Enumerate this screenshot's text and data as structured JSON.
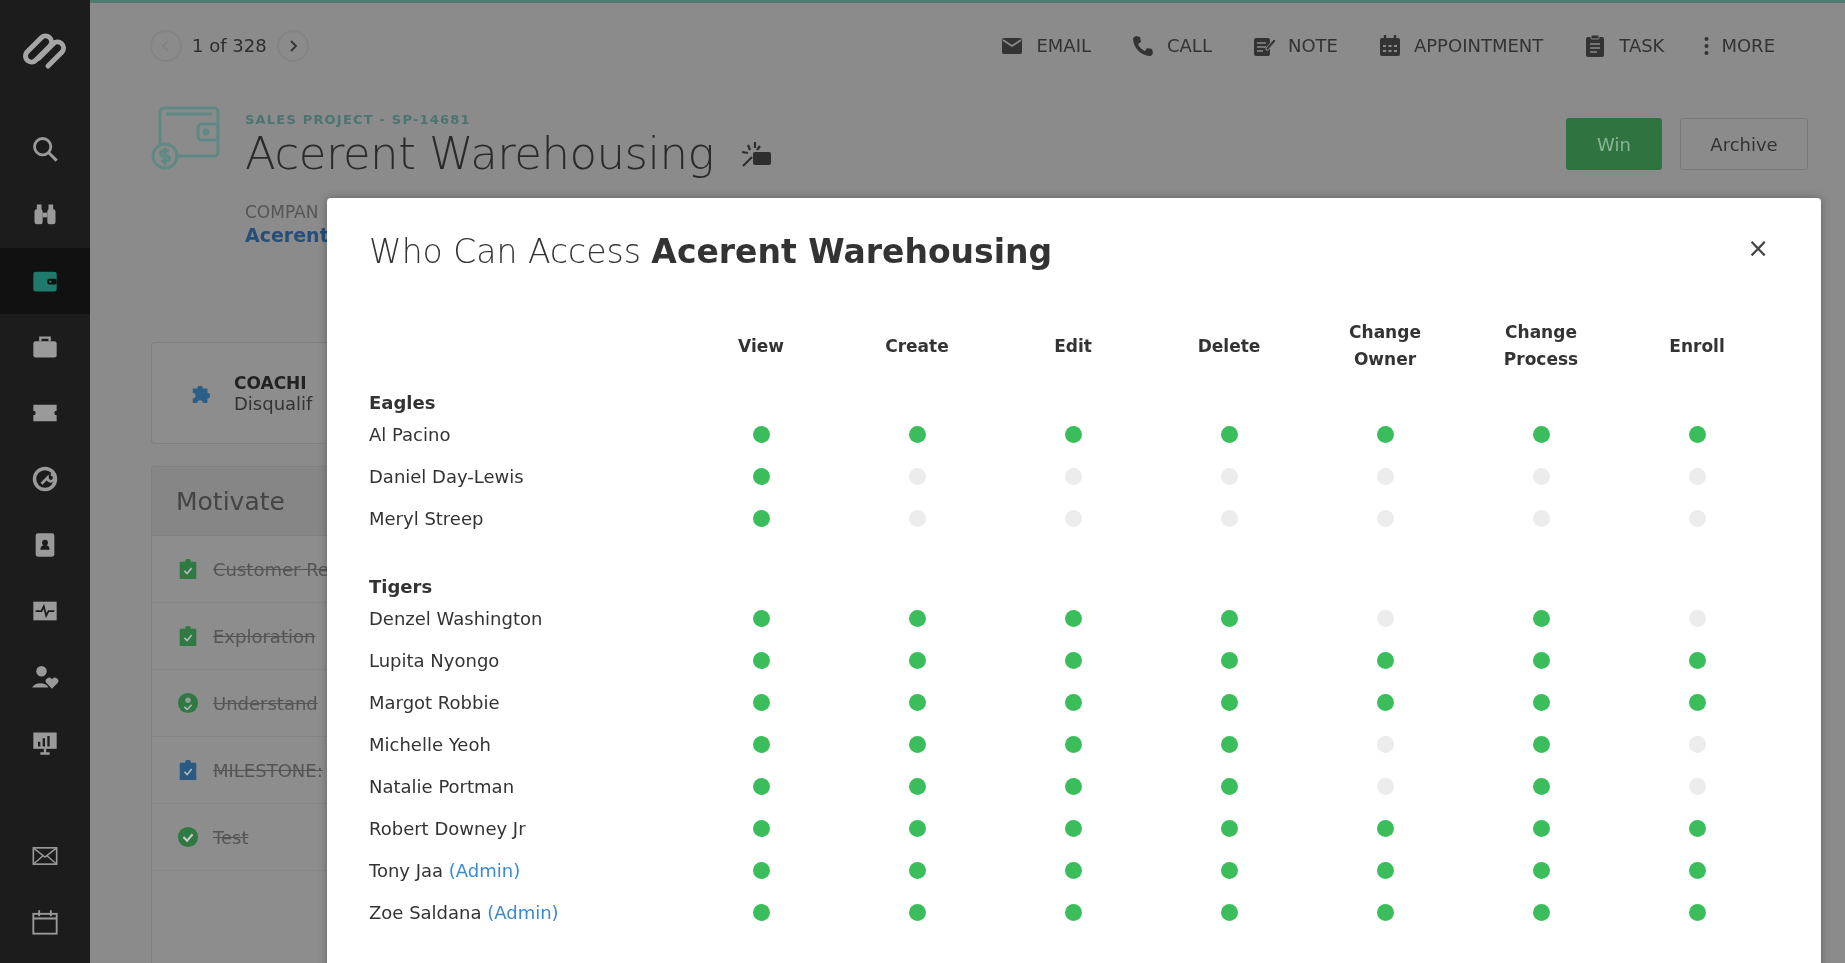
{
  "sidebar": {
    "items": [
      {
        "kind": "search",
        "selected": false
      },
      {
        "kind": "binoculars",
        "selected": false
      },
      {
        "kind": "wallet",
        "selected": true
      },
      {
        "kind": "briefcase",
        "selected": false
      },
      {
        "kind": "ticket",
        "selected": false
      },
      {
        "kind": "wrench",
        "selected": false
      },
      {
        "kind": "contacts",
        "selected": false
      },
      {
        "kind": "pulse",
        "selected": false
      },
      {
        "kind": "person-heart",
        "selected": false
      },
      {
        "kind": "chart",
        "selected": false
      }
    ],
    "bottom_items": [
      {
        "kind": "envelope",
        "selected": false
      },
      {
        "kind": "calendar",
        "selected": false
      }
    ]
  },
  "pager": {
    "position": "1 of 328"
  },
  "actions": [
    {
      "kind": "email",
      "label": "EMAIL"
    },
    {
      "kind": "call",
      "label": "CALL"
    },
    {
      "kind": "note",
      "label": "NOTE"
    },
    {
      "kind": "appointment",
      "label": "APPOINTMENT"
    },
    {
      "kind": "task",
      "label": "TASK"
    },
    {
      "kind": "more",
      "label": "MORE"
    }
  ],
  "record": {
    "eyebrow": "SALES PROJECT - SP-14681",
    "title": "Acerent Warehousing",
    "buttons": [
      {
        "kind": "primary",
        "label": "Win"
      },
      {
        "kind": "secondary",
        "label": "Archive"
      }
    ]
  },
  "company": {
    "label": "COMPAN",
    "value": "Acerent"
  },
  "coaching": {
    "title": "COACHI",
    "subtitle": "Disqualif"
  },
  "motivate": {
    "title": "Motivate",
    "tasks": [
      {
        "kind": "clipboard",
        "color": "#2f7a42",
        "label": "Customer Re",
        "done": true
      },
      {
        "kind": "clipboard",
        "color": "#2f7a42",
        "label": "Exploration",
        "done": true
      },
      {
        "kind": "target",
        "color": "#2f7a42",
        "label": "Understand",
        "done": true
      },
      {
        "kind": "clipboard",
        "color": "#2a5a82",
        "label": "MILESTONE:",
        "done": true
      },
      {
        "kind": "check",
        "color": "#2f7a42",
        "label": "Test",
        "done": true
      }
    ]
  },
  "modal": {
    "title": "Who Can Access **Acerent Warehousing**",
    "close": "×",
    "columns": [
      "View",
      "Create",
      "Edit",
      "Delete",
      "Change Owner",
      "Change Process",
      "Enroll"
    ],
    "groups": [
      {
        "name": "Eagles",
        "members": [
          {
            "name": "Al Pacino",
            "access": [
              true,
              true,
              true,
              true,
              true,
              true,
              true
            ]
          },
          {
            "name": "Daniel Day-Lewis",
            "access": [
              true,
              false,
              false,
              false,
              false,
              false,
              false
            ]
          },
          {
            "name": "Meryl Streep",
            "access": [
              true,
              false,
              false,
              false,
              false,
              false,
              false
            ]
          }
        ]
      },
      {
        "name": "Tigers",
        "members": [
          {
            "name": "Denzel Washington",
            "access": [
              true,
              true,
              true,
              true,
              false,
              true,
              false
            ]
          },
          {
            "name": "Lupita Nyongo",
            "access": [
              true,
              true,
              true,
              true,
              true,
              true,
              true
            ]
          },
          {
            "name": "Margot Robbie",
            "access": [
              true,
              true,
              true,
              true,
              true,
              true,
              true
            ]
          },
          {
            "name": "Michelle Yeoh",
            "access": [
              true,
              true,
              true,
              true,
              false,
              true,
              false
            ]
          },
          {
            "name": "Natalie Portman",
            "access": [
              true,
              true,
              true,
              true,
              false,
              true,
              false
            ]
          },
          {
            "name": "Robert Downey Jr",
            "access": [
              true,
              true,
              true,
              true,
              true,
              true,
              true
            ]
          },
          {
            "name": "Tony Jaa",
            "role": "(Admin)",
            "access": [
              true,
              true,
              true,
              true,
              true,
              true,
              true
            ]
          },
          {
            "name": "Zoe Saldana",
            "role": "(Admin)",
            "access": [
              true,
              true,
              true,
              true,
              true,
              true,
              true
            ]
          }
        ]
      }
    ]
  }
}
